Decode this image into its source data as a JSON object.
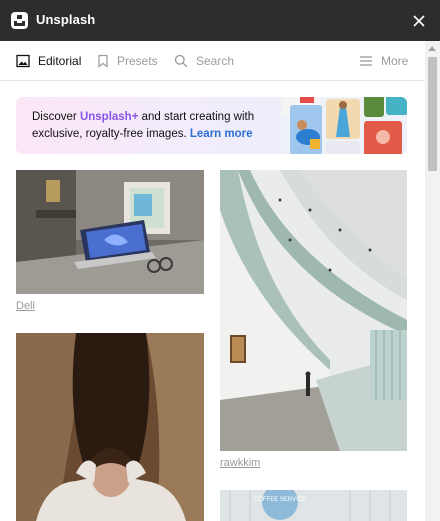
{
  "app": {
    "title": "Unsplash"
  },
  "toolbar": {
    "editorial": "Editorial",
    "presets": "Presets",
    "search": "Search",
    "more": "More"
  },
  "promo": {
    "discover": "Discover ",
    "brand": "Unsplash+",
    "rest": " and start creating with exclusive, royalty-free images. ",
    "learn_more": "Learn more"
  },
  "photos": {
    "dell": {
      "credit": "Dell",
      "alt": "Laptop on desk"
    },
    "rawkkim": {
      "credit": "rawkkim",
      "alt": "Curved building corridor"
    },
    "woman": {
      "alt": "Woman in sweater"
    },
    "building": {
      "alt": "Building with round sign",
      "sign": "COFFEE SERVICE"
    }
  },
  "colors": {
    "titlebar": "#2d2d2d",
    "brand_purple": "#8a55e6",
    "link_blue": "#2a6fd6",
    "muted": "#9a9a9a"
  },
  "icons": [
    "unsplash-logo-icon",
    "close-icon",
    "image-icon",
    "bookmark-icon",
    "search-icon",
    "menu-icon"
  ]
}
